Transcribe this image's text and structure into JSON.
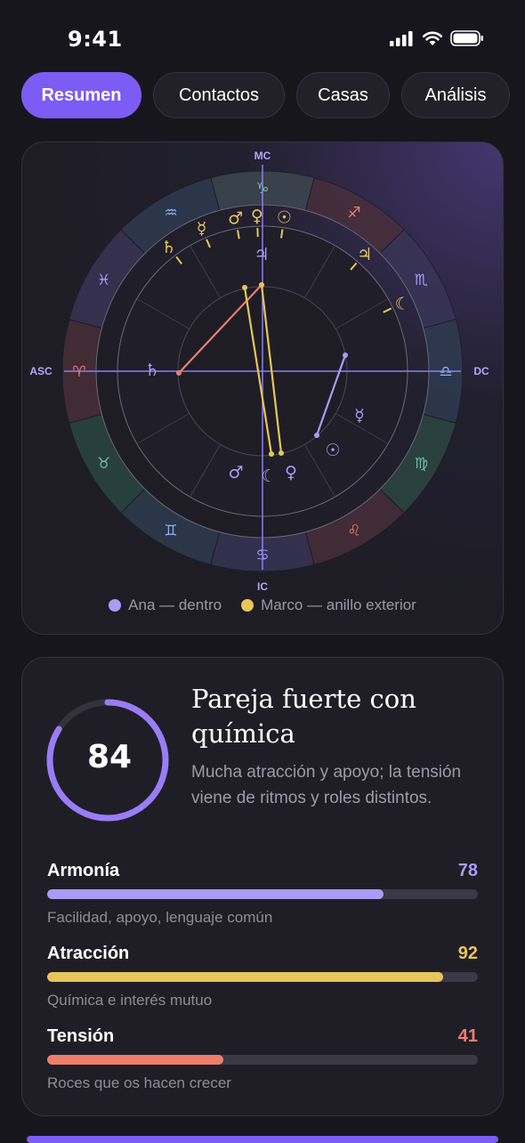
{
  "status_bar": {
    "time": "9:41"
  },
  "tabs": [
    {
      "label": "Resumen",
      "active": true
    },
    {
      "label": "Contactos",
      "active": false
    },
    {
      "label": "Casas",
      "active": false
    },
    {
      "label": "Análisis",
      "active": false
    }
  ],
  "chart": {
    "axis_labels": {
      "top": "MC",
      "bottom": "IC",
      "left": "ASC",
      "right": "DC"
    },
    "zodiac_signs": [
      "♑",
      "♐",
      "♏",
      "♎",
      "♍",
      "♌",
      "♋",
      "♊",
      "♉",
      "♈",
      "♓",
      "♒"
    ],
    "outer_ring_planets": [
      "♄",
      "☿",
      "♂",
      "♀",
      "☉",
      "♃",
      "☾"
    ],
    "inner_planets": [
      "♃",
      "♄",
      "☿",
      "☉",
      "♂",
      "☾",
      "♀"
    ],
    "legend": [
      {
        "label": "Ana — dentro",
        "color": "#a99cf5"
      },
      {
        "label": "Marco — anillo exterior",
        "color": "#e8c55a"
      }
    ]
  },
  "summary": {
    "score": "84",
    "score_fraction": 0.84,
    "title": "Pareja fuerte con química",
    "description": "Mucha atracción y apoyo; la tensión viene de ritmos y roles distintos.",
    "metrics": [
      {
        "label": "Armonía",
        "value": "78",
        "fraction": 0.78,
        "color": "#a99cf5",
        "subtitle": "Facilidad, apoyo, lenguaje común"
      },
      {
        "label": "Atracción",
        "value": "92",
        "fraction": 0.92,
        "color": "#e8c55a",
        "subtitle": "Química e interés mutuo"
      },
      {
        "label": "Tensión",
        "value": "41",
        "fraction": 0.41,
        "color": "#ef7d6c",
        "subtitle": "Roces que os hacen crecer"
      }
    ]
  },
  "colors": {
    "accent": "#7c5cf4",
    "ana": "#a99cf5",
    "marco": "#e8c55a",
    "tension": "#ef7d6c"
  }
}
